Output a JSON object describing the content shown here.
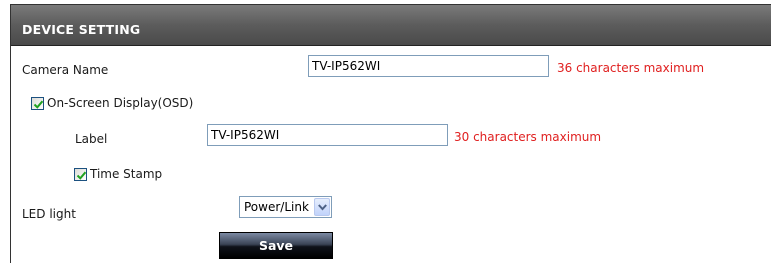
{
  "section": {
    "title": "DEVICE SETTING"
  },
  "camera_name": {
    "label": "Camera Name",
    "value": "TV-IP562WI",
    "hint": "36 characters maximum"
  },
  "osd": {
    "label": "On-Screen Display(OSD)",
    "checked": true
  },
  "osd_label": {
    "label": "Label",
    "value": "TV-IP562WI",
    "hint": "30 characters maximum"
  },
  "time_stamp": {
    "label": "Time Stamp",
    "checked": true
  },
  "led_light": {
    "label": "LED light",
    "selected": "Power/Link"
  },
  "actions": {
    "save_label": "Save"
  },
  "colors": {
    "header_bg": "#5c5c5c",
    "hint_text": "#e02020",
    "checkmark": "#21a121"
  }
}
